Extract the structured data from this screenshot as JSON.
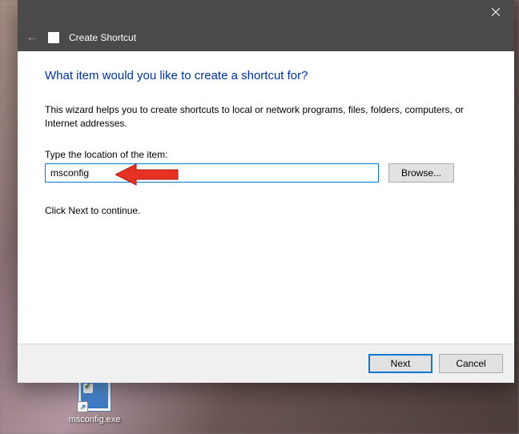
{
  "dialog": {
    "title": "Create Shortcut",
    "heading": "What item would you like to create a shortcut for?",
    "description": "This wizard helps you to create shortcuts to local or network programs, files, folders, computers, or Internet addresses.",
    "location_label": "Type the location of the item:",
    "location_value": "msconfig",
    "browse_label": "Browse...",
    "continue_hint": "Click Next to continue.",
    "next_label": "Next",
    "cancel_label": "Cancel"
  },
  "desktop": {
    "icon_label": "msconfig.exe"
  },
  "colors": {
    "accent": "#0078d7",
    "heading": "#003399",
    "titlebar": "#4a4a4a",
    "arrow": "#e53222"
  }
}
